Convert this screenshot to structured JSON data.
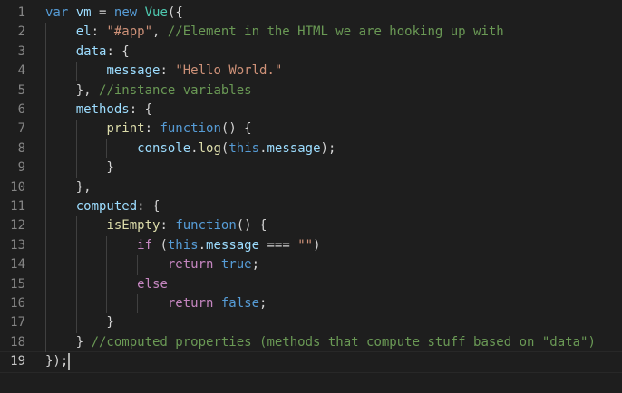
{
  "editor": {
    "language": "javascript",
    "current_line": 19,
    "colors": {
      "background": "#1e1e1e",
      "line_number": "#858585",
      "keyword": "#569cd6",
      "control": "#c586c0",
      "property": "#9cdcfe",
      "string": "#ce9178",
      "comment": "#6a9955",
      "function": "#dcdcaa",
      "class": "#4ec9b0",
      "text": "#d4d4d4"
    },
    "lines": [
      {
        "number": "1",
        "tokens": [
          {
            "t": "var",
            "k": "keyword"
          },
          {
            "t": " "
          },
          {
            "t": "vm",
            "k": "prop"
          },
          {
            "t": " = "
          },
          {
            "t": "new",
            "k": "keyword"
          },
          {
            "t": " "
          },
          {
            "t": "Vue",
            "k": "class"
          },
          {
            "t": "({"
          }
        ]
      },
      {
        "number": "2",
        "tokens": [
          {
            "t": "    "
          },
          {
            "t": "el",
            "k": "prop"
          },
          {
            "t": ": "
          },
          {
            "t": "\"#app\"",
            "k": "string"
          },
          {
            "t": ", "
          },
          {
            "t": "//Element in the HTML we are hooking up with",
            "k": "comment"
          }
        ]
      },
      {
        "number": "3",
        "tokens": [
          {
            "t": "    "
          },
          {
            "t": "data",
            "k": "prop"
          },
          {
            "t": ": {"
          }
        ]
      },
      {
        "number": "4",
        "tokens": [
          {
            "t": "        "
          },
          {
            "t": "message",
            "k": "prop"
          },
          {
            "t": ": "
          },
          {
            "t": "\"Hello World.\"",
            "k": "string"
          }
        ]
      },
      {
        "number": "5",
        "tokens": [
          {
            "t": "    }, "
          },
          {
            "t": "//instance variables",
            "k": "comment"
          }
        ]
      },
      {
        "number": "6",
        "tokens": [
          {
            "t": "    "
          },
          {
            "t": "methods",
            "k": "prop"
          },
          {
            "t": ": {"
          }
        ]
      },
      {
        "number": "7",
        "tokens": [
          {
            "t": "        "
          },
          {
            "t": "print",
            "k": "func"
          },
          {
            "t": ": "
          },
          {
            "t": "function",
            "k": "keyword"
          },
          {
            "t": "() {"
          }
        ]
      },
      {
        "number": "8",
        "tokens": [
          {
            "t": "            "
          },
          {
            "t": "console",
            "k": "prop"
          },
          {
            "t": "."
          },
          {
            "t": "log",
            "k": "func"
          },
          {
            "t": "("
          },
          {
            "t": "this",
            "k": "keyword"
          },
          {
            "t": "."
          },
          {
            "t": "message",
            "k": "prop"
          },
          {
            "t": ");"
          }
        ]
      },
      {
        "number": "9",
        "tokens": [
          {
            "t": "        }"
          }
        ]
      },
      {
        "number": "10",
        "tokens": [
          {
            "t": "    },"
          }
        ]
      },
      {
        "number": "11",
        "tokens": [
          {
            "t": "    "
          },
          {
            "t": "computed",
            "k": "prop"
          },
          {
            "t": ": {"
          }
        ]
      },
      {
        "number": "12",
        "tokens": [
          {
            "t": "        "
          },
          {
            "t": "isEmpty",
            "k": "func"
          },
          {
            "t": ": "
          },
          {
            "t": "function",
            "k": "keyword"
          },
          {
            "t": "() {"
          }
        ]
      },
      {
        "number": "13",
        "tokens": [
          {
            "t": "            "
          },
          {
            "t": "if",
            "k": "control"
          },
          {
            "t": " ("
          },
          {
            "t": "this",
            "k": "keyword"
          },
          {
            "t": "."
          },
          {
            "t": "message",
            "k": "prop"
          },
          {
            "t": " === "
          },
          {
            "t": "\"\"",
            "k": "string"
          },
          {
            "t": ")"
          }
        ]
      },
      {
        "number": "14",
        "tokens": [
          {
            "t": "                "
          },
          {
            "t": "return",
            "k": "control"
          },
          {
            "t": " "
          },
          {
            "t": "true",
            "k": "keyword"
          },
          {
            "t": ";"
          }
        ]
      },
      {
        "number": "15",
        "tokens": [
          {
            "t": "            "
          },
          {
            "t": "else",
            "k": "control"
          }
        ]
      },
      {
        "number": "16",
        "tokens": [
          {
            "t": "                "
          },
          {
            "t": "return",
            "k": "control"
          },
          {
            "t": " "
          },
          {
            "t": "false",
            "k": "keyword"
          },
          {
            "t": ";"
          }
        ]
      },
      {
        "number": "17",
        "tokens": [
          {
            "t": "        }"
          }
        ]
      },
      {
        "number": "18",
        "tokens": [
          {
            "t": "    } "
          },
          {
            "t": "//computed properties (methods that compute stuff based on \"data\")",
            "k": "comment"
          }
        ]
      },
      {
        "number": "19",
        "tokens": [
          {
            "t": "});"
          }
        ]
      }
    ]
  }
}
